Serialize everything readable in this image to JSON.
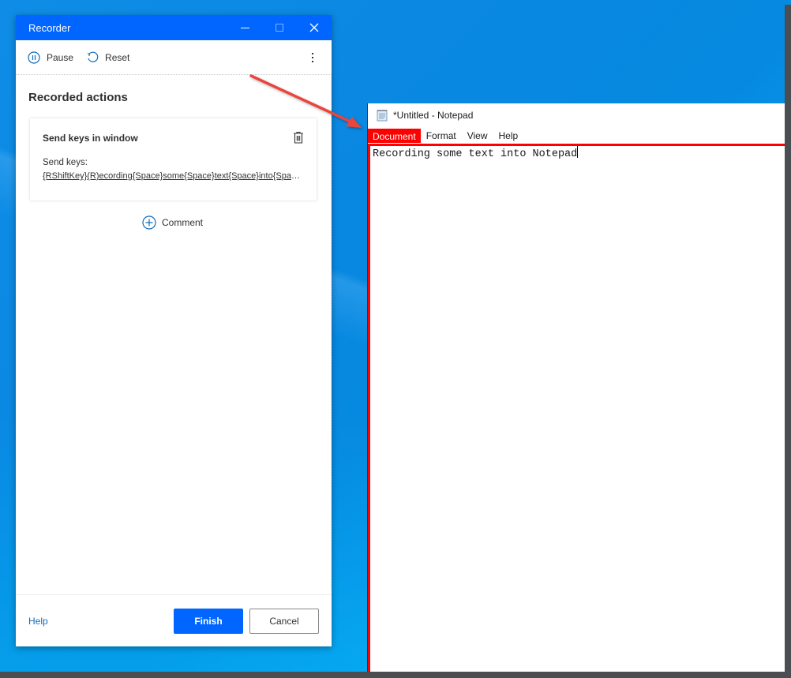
{
  "recorder": {
    "title": "Recorder",
    "window_controls": {
      "minimize": "minimize",
      "maximize": "maximize",
      "close": "close"
    },
    "toolbar": {
      "pause_label": "Pause",
      "reset_label": "Reset",
      "more_label": "More options"
    },
    "heading": "Recorded actions",
    "actions": [
      {
        "title": "Send keys in window",
        "param_label": "Send keys:",
        "param_value": "{RShiftKey}(R)ecording{Space}some{Space}text{Space}into{Space}Notepad"
      }
    ],
    "comment_label": "Comment",
    "footer": {
      "help_label": "Help",
      "finish_label": "Finish",
      "cancel_label": "Cancel"
    },
    "colors": {
      "accent": "#0066ff",
      "link": "#0f6cbd"
    }
  },
  "notepad": {
    "title": "*Untitled - Notepad",
    "menu": [
      {
        "label": "Document",
        "highlighted": true
      },
      {
        "label": "Format",
        "highlighted": false
      },
      {
        "label": "View",
        "highlighted": false
      },
      {
        "label": "Help",
        "highlighted": false
      }
    ],
    "content": "Recording some text into Notepad",
    "highlight_color": "#ff0000"
  },
  "annotation": {
    "arrow_color": "#e8453c",
    "points_from": "recorder",
    "points_to": "notepad"
  }
}
